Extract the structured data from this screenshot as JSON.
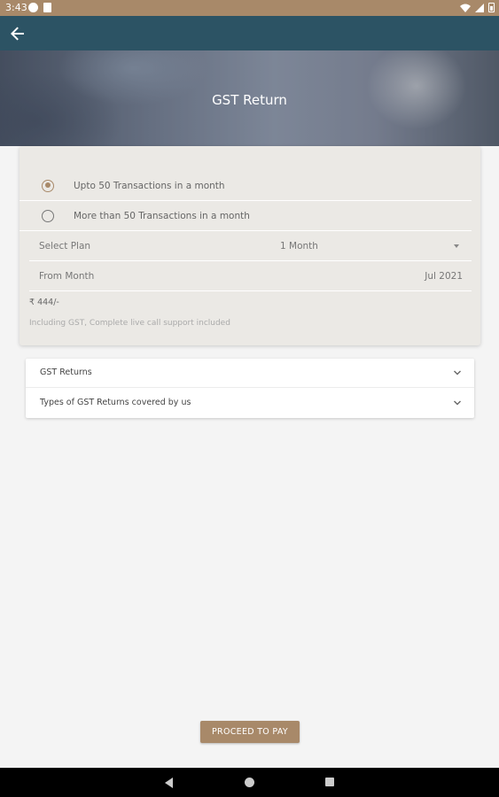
{
  "status_bar": {
    "time": "3:43",
    "icons": [
      "g-notification-icon",
      "document-icon",
      "wifi-icon",
      "signal-icon",
      "battery-icon"
    ]
  },
  "app_bar": {
    "back_icon": "arrow-left-icon"
  },
  "hero": {
    "title": "GST Return"
  },
  "plan_options": [
    {
      "label": "Upto 50 Transactions in a month",
      "selected": true
    },
    {
      "label": "More than 50 Transactions in a month",
      "selected": false
    }
  ],
  "select_plan": {
    "label": "Select Plan",
    "value": "1 Month"
  },
  "from_month": {
    "label": "From Month",
    "value": "Jul 2021"
  },
  "price": "₹ 444/-",
  "note": "Including GST, Complete live call support included",
  "accordion": [
    {
      "title": "GST Returns"
    },
    {
      "title": "Types of GST Returns covered by us"
    }
  ],
  "proceed_button": "PROCEED TO PAY",
  "colors": {
    "status_bar": "#a88969",
    "app_bar": "#2c5364",
    "accent": "#a88969",
    "card": "#ebe9e5",
    "background": "#f4f4f4"
  }
}
